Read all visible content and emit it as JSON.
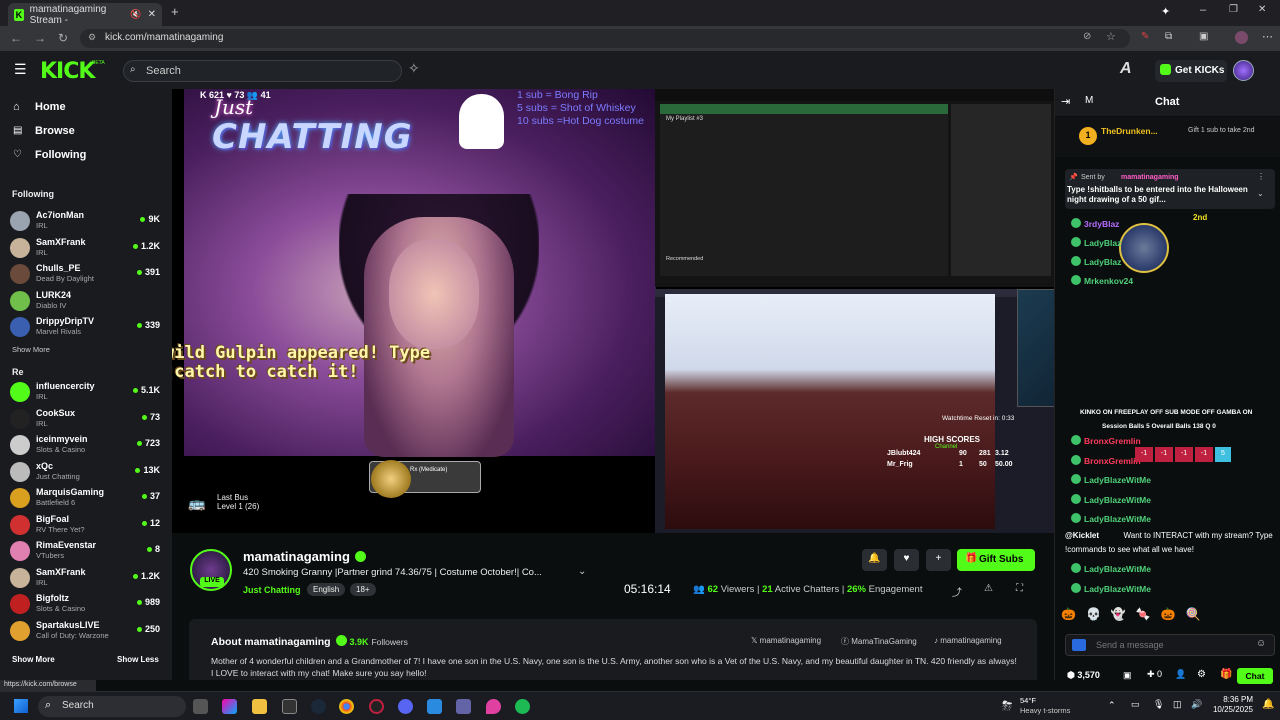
{
  "browser": {
    "tab_title": "mamatinagaming Stream - ",
    "new_tab": "+",
    "url": "kick.com/mamatinagaming",
    "status_url": "https://kick.com/browse"
  },
  "header": {
    "logo": "KICK",
    "logo_badge": "BETA",
    "search_placeholder": "Search",
    "get_kicks": "Get KICKs"
  },
  "sidebar": {
    "nav": [
      "Home",
      "Browse",
      "Following"
    ],
    "following_title": "Following",
    "show_more_mid": "Show More",
    "recommended_title": "Re",
    "channels": [
      {
        "name": "Ac7ionMan",
        "category": "IRL",
        "viewers": "9K",
        "color": "#9aa3b0"
      },
      {
        "name": "SamXFrank",
        "category": "IRL",
        "viewers": "1.2K",
        "color": "#c7b29a"
      },
      {
        "name": "Chulls_PE",
        "category": "Dead By Daylight",
        "viewers": "391",
        "color": "#6a4a3a"
      },
      {
        "name": "LURK24",
        "category": "Diablo IV",
        "viewers": "",
        "color": "#6fbf4a"
      },
      {
        "name": "DrippyDripTV",
        "category": "Marvel Rivals",
        "viewers": "339",
        "color": "#3a5fb0"
      }
    ],
    "recommended": [
      {
        "name": "influencercity",
        "category": "IRL",
        "viewers": "5.1K",
        "color": "#53fc18"
      },
      {
        "name": "CookSux",
        "category": "IRL",
        "viewers": "73",
        "color": "#222"
      },
      {
        "name": "iceinmyvein",
        "category": "Slots & Casino",
        "viewers": "723",
        "color": "#ccc"
      },
      {
        "name": "xQc",
        "category": "Just Chatting",
        "viewers": "13K",
        "color": "#bbb"
      },
      {
        "name": "MarquisGaming",
        "category": "Battlefield 6",
        "viewers": "37",
        "color": "#d9a020"
      },
      {
        "name": "BigFoal",
        "category": "RV There Yet?",
        "viewers": "12",
        "color": "#d03030"
      },
      {
        "name": "RimaEvenstar",
        "category": "VTubers",
        "viewers": "8",
        "color": "#e080b0"
      },
      {
        "name": "SamXFrank",
        "category": "IRL",
        "viewers": "1.2K",
        "color": "#c7b29a"
      },
      {
        "name": "Bigfoltz",
        "category": "Slots & Casino",
        "viewers": "989",
        "color": "#c02020"
      },
      {
        "name": "SpartakusLIVE",
        "category": "Call of Duty: Warzone",
        "viewers": "250",
        "color": "#e0a030"
      }
    ],
    "show_more": "Show More",
    "show_less": "Show Less"
  },
  "video": {
    "overlay_stats": "K 621   ♥ 73   👥 41",
    "title_small": "Just",
    "title_big": "CHATTING",
    "sub_goals": [
      "1 sub = Bong Rip",
      "5 subs = Shot of Whiskey",
      "10 subs =Hot Dog costume"
    ],
    "wild_text": "wild Gulpin appeared! Type\n!catch to catch it!",
    "last_bus": "Last Bus",
    "last_bus_level": "Level 1  (26)",
    "medicate": "Rx (Medicate)",
    "playlist_title": "My Playlist #3",
    "recommended_label": "Recommended",
    "watchtime": "Watchtime Reset in: 0:33",
    "high_scores": "HIGH SCORES",
    "channel_label": "Channel",
    "scores": [
      {
        "name": "JBlubt424",
        "a": "90",
        "b": "281",
        "c": "3.12"
      },
      {
        "name": "Mr_Frig",
        "a": "1",
        "b": "50",
        "c": "50.00"
      }
    ]
  },
  "stream": {
    "live": "LIVE",
    "name": "mamatinagaming",
    "title": "420 Smoking Granny |Partner grind 74.36/75 |  Costume October!| Co...",
    "category": "Just Chatting",
    "tags": [
      "English",
      "18+"
    ],
    "uptime": "05:16:14",
    "viewers_n": "62",
    "viewers_label": "Viewers",
    "chatters_n": "21",
    "chatters_label": "Active Chatters",
    "engagement_n": "26%",
    "engagement_label": "Engagement",
    "gift_subs": "Gift Subs"
  },
  "about": {
    "title": "About mamatinagaming",
    "followers": "3.9K",
    "followers_label": "Followers",
    "x": "mamatinagaming",
    "facebook": "MamaTinaGaming",
    "tiktok": "mamatinagaming",
    "bio": "Mother of 4 wonderful children and a Grandmother of 7! I have one son in the U.S. Navy, one son is the U.S. Army, another son who is a Vet of the U.S. Navy, and my beautiful daughter in TN. 420 friendly as always! I LOVE to interact with my chat! Make sure you say hello!"
  },
  "chat": {
    "title": "Chat",
    "m": "M",
    "top_gifter": "TheDrunken...",
    "gift_rank": "1",
    "gift_prompt": "Gift 1 sub to take 2nd",
    "sent_by": "Sent by",
    "sent_by_user": "mamatinagaming",
    "pinned_text": "Type !shitballs to be entered into the Halloween night drawing of a 50 gif...",
    "pinned_rank": "2nd",
    "messages": [
      {
        "user": "3rdyBlaz",
        "text": "",
        "cls": "u"
      },
      {
        "user": "LadyBlaz",
        "text": "",
        "cls": "ua"
      },
      {
        "user": "LadyBlaz",
        "text": "",
        "cls": "ua"
      },
      {
        "user": "Mrkenkov24",
        "text": "",
        "cls": "ua"
      }
    ],
    "stat_row": "KINKO ON   FREEPLAY OFF   SUB MODE OFF   GAMBA ON",
    "session_row": "Session Balls  5    Overall Balls  138    Q  0",
    "messages2": [
      {
        "user": "BronxGremlin",
        "text": "",
        "cls": "ub"
      },
      {
        "user": "BronxGremlin",
        "text": "",
        "cls": "ub"
      },
      {
        "user": "LadyBlazeWitMe",
        "text": "",
        "cls": "ua"
      },
      {
        "user": "LadyBlazeWitMe",
        "text": "",
        "cls": "ua"
      },
      {
        "user": "LadyBlazeWitMe",
        "text": "",
        "cls": "ua"
      }
    ],
    "kicklet_user": "@Kicklet",
    "kicklet_text": "Want to INTERACT with my stream? Type !commands to see what all we have!",
    "messages3": [
      {
        "user": "LadyBlazeWitMe",
        "cls": "ua"
      },
      {
        "user": "LadyBlazeWitMe",
        "cls": "ua"
      }
    ],
    "placeholder": "Send a message",
    "points": "3,570",
    "plus": "0",
    "chat_button": "Chat"
  },
  "taskbar": {
    "search": "Search",
    "temp": "54°F",
    "weather": "Heavy t-storms",
    "time": "8:36 PM",
    "date": "10/25/2025"
  }
}
